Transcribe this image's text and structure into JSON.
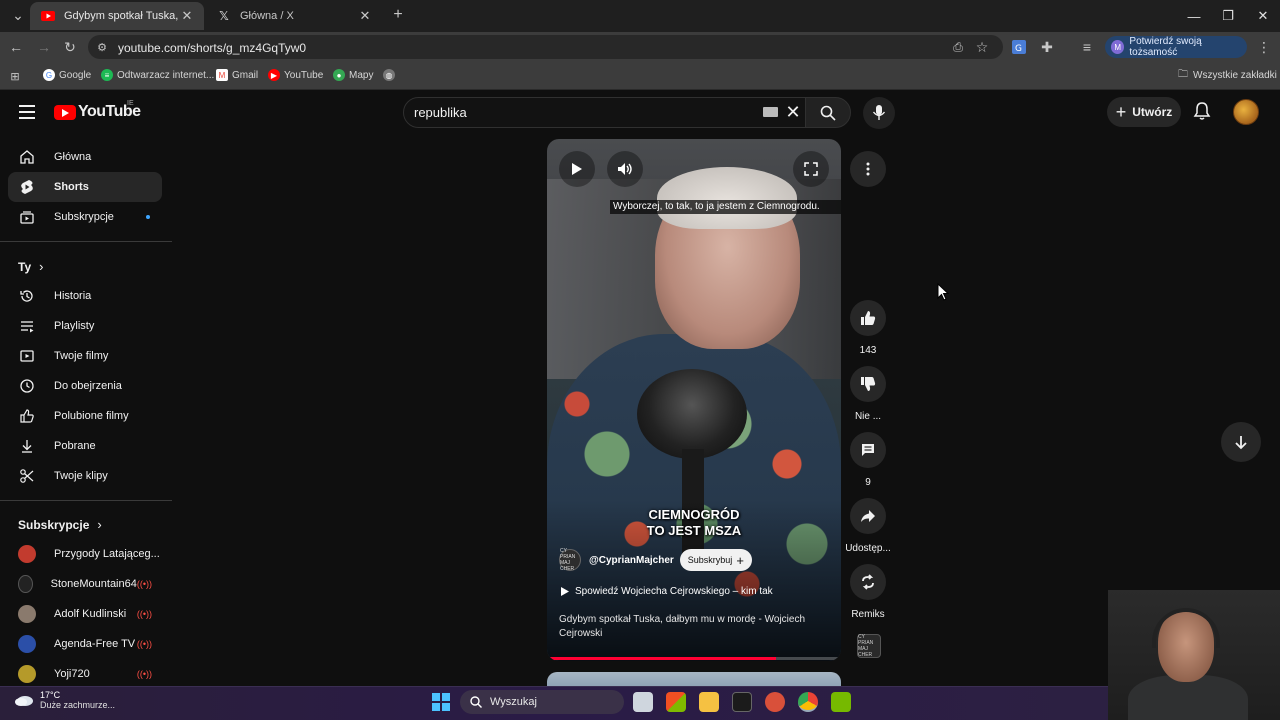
{
  "browser": {
    "tabs": [
      {
        "title": "Gdybym spotkał Tuska, dałbym",
        "active": true
      },
      {
        "title": "Główna / X",
        "active": false
      }
    ],
    "url": "youtube.com/shorts/g_mz4GqTyw0",
    "verify_label": "Potwierdź swoją tożsamość",
    "verify_avatar": "M",
    "bookmarks": [
      {
        "label": "Google",
        "color": "#4285f4",
        "icon": "G"
      },
      {
        "label": "Odtwarzacz internet...",
        "color": "#1db954",
        "icon": "≡"
      },
      {
        "label": "Gmail",
        "color": "#ea4335",
        "icon": "M"
      },
      {
        "label": "YouTube",
        "color": "#ff0000",
        "icon": "▶"
      },
      {
        "label": "Mapy",
        "color": "#34a853",
        "icon": "●"
      }
    ],
    "all_bookmarks": "Wszystkie zakładki"
  },
  "youtube": {
    "logo_text": "YouTube",
    "region": "IE",
    "search_value": "republika",
    "create_label": "Utwórz",
    "accent": "#ff0000"
  },
  "sidebar": {
    "primary": [
      {
        "label": "Główna",
        "icon": "home-icon"
      },
      {
        "label": "Shorts",
        "icon": "shorts-icon",
        "active": true
      },
      {
        "label": "Subskrypcje",
        "icon": "subscriptions-icon"
      }
    ],
    "you_title": "Ty",
    "you_items": [
      {
        "label": "Historia",
        "icon": "history-icon"
      },
      {
        "label": "Playlisty",
        "icon": "playlist-icon"
      },
      {
        "label": "Twoje filmy",
        "icon": "your-videos-icon"
      },
      {
        "label": "Do obejrzenia",
        "icon": "watch-later-icon"
      },
      {
        "label": "Polubione filmy",
        "icon": "liked-icon"
      },
      {
        "label": "Pobrane",
        "icon": "download-icon"
      },
      {
        "label": "Twoje klipy",
        "icon": "clips-icon"
      }
    ],
    "subs_title": "Subskrypcje",
    "subscriptions": [
      {
        "label": "Przygody Latająceg...",
        "color": "#c23b2e",
        "live": false
      },
      {
        "label": "StoneMountain64",
        "color": "#222222",
        "live": true
      },
      {
        "label": "Adolf Kudlinski",
        "color": "#8a7a6d",
        "live": true
      },
      {
        "label": "Agenda-Free TV",
        "color": "#2b4fa8",
        "live": true
      },
      {
        "label": "Yoji720",
        "color": "#b59a2a",
        "live": true
      }
    ]
  },
  "short": {
    "caption": "Wyborczej, to tak, to ja jestem z Ciemnogrodu.",
    "overlay_line1": "CIEMNOGRÓD",
    "overlay_line2": "TO JEST MSZA",
    "channel": "@CyprianMajcher",
    "channel_avatar_text": "CY PRIAN MAJ CHER",
    "subscribe_label": "Subskrybuj",
    "playlist": "Spowiedź Wojciecha Cejrowskiego – kim tak",
    "title": "Gdybym spotkał Tuska, dałbym mu w mordę - Wojciech Cejrowski",
    "progress": 0.78
  },
  "actions": {
    "likes": "143",
    "dislike": "Nie ...",
    "comments": "9",
    "share": "Udostęp...",
    "remix": "Remiks"
  },
  "taskbar": {
    "temperature": "17°C",
    "weather": "Duże zachmurze...",
    "search_label": "Wyszukaj"
  }
}
